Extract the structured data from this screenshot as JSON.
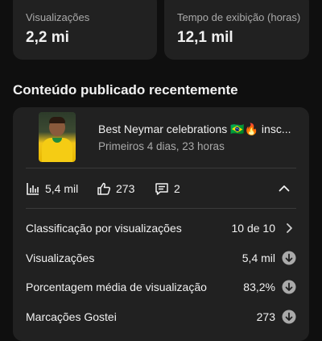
{
  "stats": {
    "views_label": "Visualizações",
    "views_value": "2,2 mi",
    "watch_label": "Tempo de exibição (horas)",
    "watch_value": "12,1 mil"
  },
  "section": {
    "title": "Conteúdo publicado recentemente"
  },
  "video": {
    "title": "Best Neymar celebrations 🇧🇷🔥 insc...",
    "subtitle": "Primeiros 4 dias, 23 horas",
    "views": "5,4 mil",
    "likes": "273",
    "comments": "2"
  },
  "details": [
    {
      "label": "Classificação por visualizações",
      "value": "10 de 10",
      "icon": "chevron-right-icon"
    },
    {
      "label": "Visualizações",
      "value": "5,4 mil",
      "icon": "arrow-down-circle-icon"
    },
    {
      "label": "Porcentagem média de visualização",
      "value": "83,2%",
      "icon": "arrow-down-circle-icon"
    },
    {
      "label": "Marcações Gostei",
      "value": "273",
      "icon": "arrow-down-circle-icon"
    }
  ]
}
